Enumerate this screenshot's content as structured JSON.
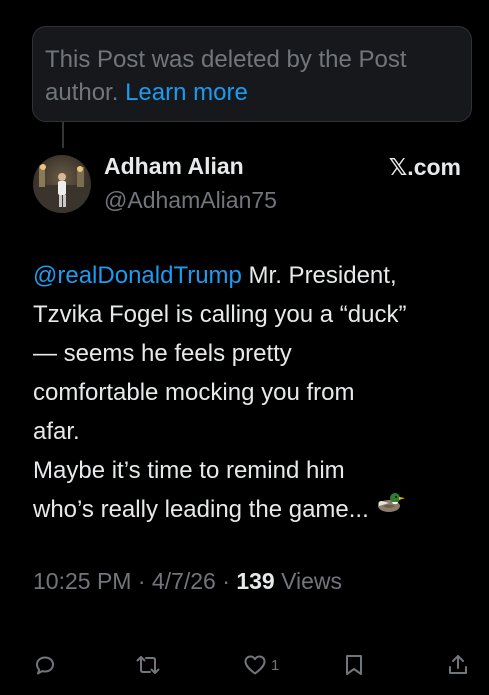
{
  "deleted_notice": {
    "text": "This Post was deleted by the Post author.",
    "link_label": "Learn more"
  },
  "author": {
    "name": "Adham Alian",
    "handle": "@AdhamAlian75"
  },
  "source_badge": "𝕏.com",
  "post": {
    "mention": "@realDonaldTrump",
    "line1_rest": " Mr. President,",
    "line2": "Tzvika Fogel is calling you a “duck”",
    "line3": "— seems he feels pretty",
    "line4": "comfortable mocking you from",
    "line5": "afar.",
    "line6": "Maybe it’s time to remind him",
    "line7": "who’s really leading the game...",
    "emoji": "duck"
  },
  "meta": {
    "time": "10:25 PM",
    "sep1": " · ",
    "date": "4/7/26",
    "sep2": " · ",
    "views_count": "139",
    "views_label": " Views"
  },
  "actions": {
    "reply_icon": "reply-icon",
    "repost_icon": "repost-icon",
    "like_icon": "heart-icon",
    "like_count": "1",
    "bookmark_icon": "bookmark-icon",
    "share_icon": "share-icon"
  },
  "colors": {
    "background": "#000000",
    "text": "#e7e9ea",
    "muted": "#71767b",
    "link": "#1d9bf0",
    "box": "#16181c"
  }
}
